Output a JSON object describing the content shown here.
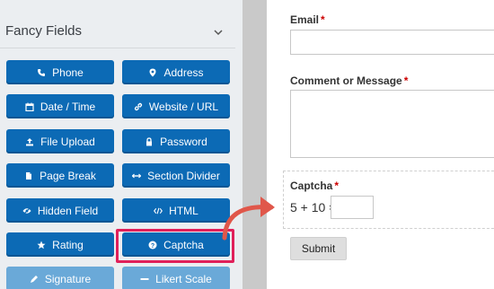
{
  "sidebar": {
    "title": "Fancy Fields",
    "buttons": [
      {
        "label": "Phone",
        "icon": "phone-icon"
      },
      {
        "label": "Address",
        "icon": "map-pin-icon"
      },
      {
        "label": "Date / Time",
        "icon": "calendar-icon"
      },
      {
        "label": "Website / URL",
        "icon": "link-icon"
      },
      {
        "label": "File Upload",
        "icon": "upload-icon"
      },
      {
        "label": "Password",
        "icon": "lock-icon"
      },
      {
        "label": "Page Break",
        "icon": "page-break-icon"
      },
      {
        "label": "Section Divider",
        "icon": "divider-icon"
      },
      {
        "label": "Hidden Field",
        "icon": "eye-slash-icon"
      },
      {
        "label": "HTML",
        "icon": "code-icon"
      },
      {
        "label": "Rating",
        "icon": "star-icon"
      },
      {
        "label": "Captcha",
        "icon": "question-circle-icon"
      },
      {
        "label": "Signature",
        "icon": "pen-icon"
      },
      {
        "label": "Likert Scale",
        "icon": "dots-icon"
      }
    ]
  },
  "form": {
    "email_label": "Email",
    "comment_label": "Comment or Message",
    "captcha_label": "Captcha",
    "required_mark": "*",
    "captcha_question": "5 + 10 =",
    "captcha_answer": "",
    "submit_label": "Submit"
  },
  "colors": {
    "button_blue": "#0c6ab5",
    "highlight": "#e0205a",
    "arrow": "#e0574a"
  }
}
